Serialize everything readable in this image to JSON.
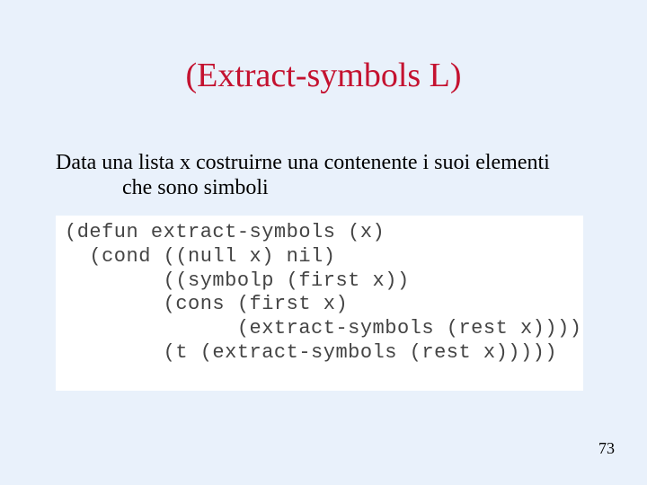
{
  "title": "(Extract-symbols L)",
  "description": {
    "line1": "Data una lista x costruirne una contenente i suoi elementi",
    "line2": "che sono simboli"
  },
  "code": {
    "l1": "(defun extract-symbols (x)",
    "l2": "  (cond ((null x) nil)",
    "l3": "        ((symbolp (first x))",
    "l4": "        (cons (first x)",
    "l5": "              (extract-symbols (rest x))))",
    "l6": "        (t (extract-symbols (rest x)))))"
  },
  "page_number": "73"
}
